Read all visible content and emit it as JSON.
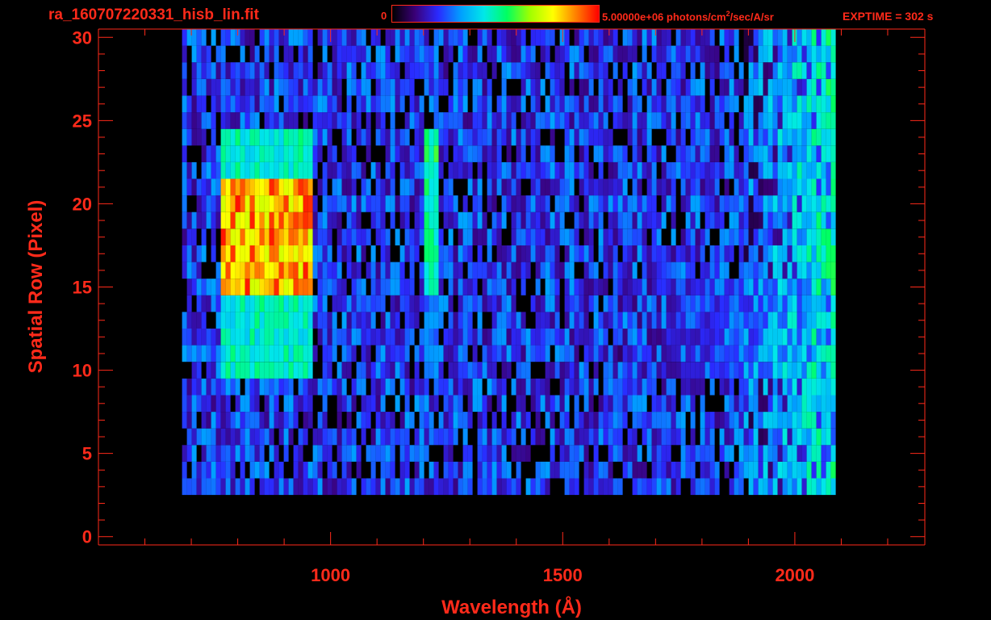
{
  "header": {
    "filename": "ra_160707220331_hisb_lin.fit",
    "colorbar_min": "0",
    "colorbar_max_value": "5.00000e+06",
    "colorbar_units_pre": "photons/cm",
    "colorbar_units_sup": "2",
    "colorbar_units_post": "/sec/A/sr",
    "exptime": "EXPTIME = 302 s"
  },
  "colors": {
    "background": "#000000",
    "axis": "#ff2a1a",
    "text": "#ff2a1a",
    "colormap": [
      "#000000",
      "#3a0078",
      "#2a2aff",
      "#00a0ff",
      "#00e8e8",
      "#00ff60",
      "#a0ff00",
      "#ffff00",
      "#ff8000",
      "#ff0000"
    ]
  },
  "chart_data": {
    "type": "heatmap",
    "title": "ra_160707220331_hisb_lin.fit",
    "xlabel": "Wavelength (Å)",
    "ylabel": "Spatial Row (Pixel)",
    "xlim": [
      500,
      2280
    ],
    "ylim": [
      -0.5,
      30.5
    ],
    "x_ticks": [
      1000,
      1500,
      2000
    ],
    "y_ticks": [
      0,
      5,
      10,
      15,
      20,
      25,
      30
    ],
    "x_minor_step": 100,
    "y_minor_step": 1,
    "colorbar": {
      "min": 0,
      "max": 5000000,
      "units": "photons/cm^2/sec/A/sr"
    },
    "data_extent": {
      "x": [
        680,
        2080
      ],
      "rows": [
        3,
        30
      ]
    },
    "features": [
      {
        "name": "bright band",
        "x": [
          760,
          960
        ],
        "rows": [
          10,
          24
        ],
        "peak_rows": [
          15,
          21
        ],
        "peak_value_fraction": 0.9
      },
      {
        "name": "narrow line",
        "x": [
          1195,
          1230
        ],
        "rows": [
          10,
          24
        ],
        "peak_rows": [
          15,
          24
        ],
        "peak_value_fraction": 0.55
      },
      {
        "name": "continuum band",
        "x": [
          1600,
          2060
        ],
        "rows": [
          10,
          15
        ],
        "peak_value_fraction": 0.45
      }
    ]
  }
}
